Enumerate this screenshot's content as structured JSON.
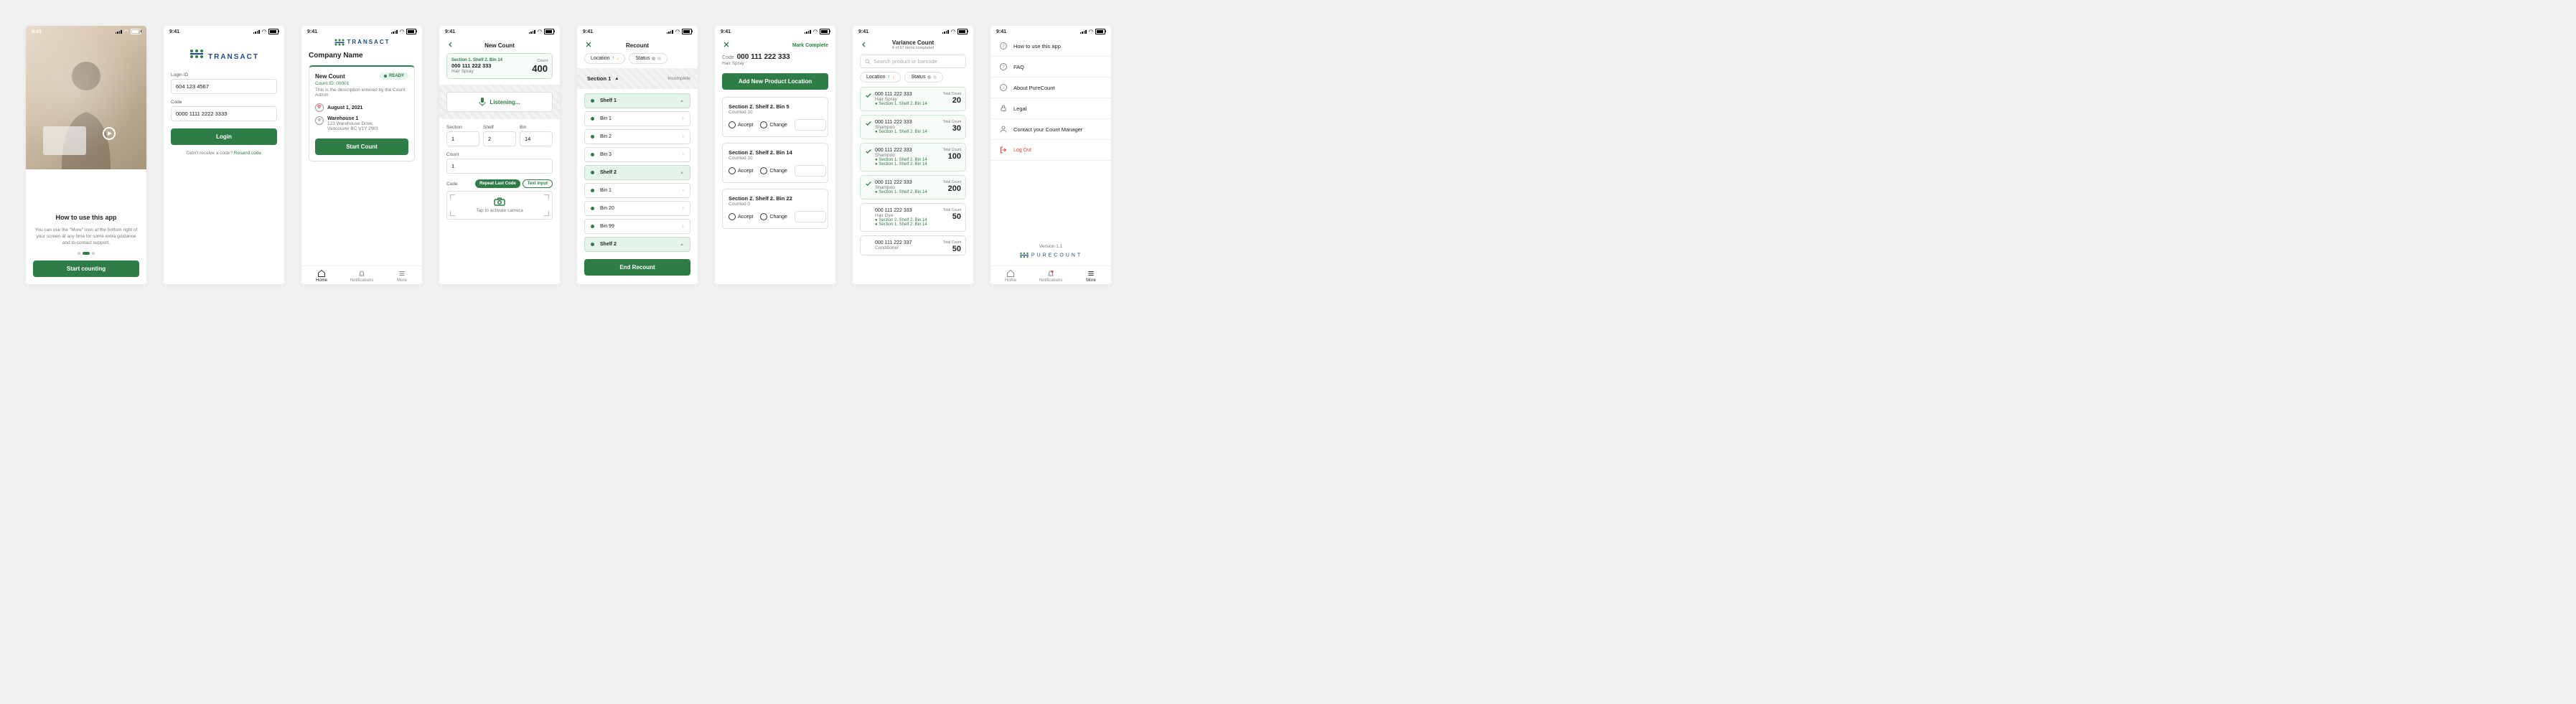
{
  "status": {
    "time": "9:41"
  },
  "brand": {
    "transact": "TRANSACT",
    "purecount": "PURECOUNT",
    "version": "Version 1.1"
  },
  "tabs": {
    "home": "Home",
    "notifications": "Notifications",
    "more": "More"
  },
  "s1": {
    "title": "How to use this app",
    "body": "You can use the \"More\" icon at the bottom right of your screen at any time for some extra guidance and to contact support.",
    "cta": "Start counting"
  },
  "s2": {
    "login_id_label": "Login ID",
    "login_id_value": "604 123 4567",
    "code_label": "Code",
    "code_value": "0000 1111 2222 3333",
    "login_btn": "Login",
    "resend_prefix": "Didn't receive a code? ",
    "resend_link": "Resend code"
  },
  "s3": {
    "company": "Company Name",
    "new_count": "New Count",
    "count_id": "Count ID: 00001",
    "desc": "This is the description entered by the Count Admin",
    "date": "August 1, 2021",
    "warehouse": "Warehouse 1",
    "address1": "123 Warehouse Drive,",
    "address2": "Vancouver BC V1Y 2W3",
    "ready": "READY",
    "start": "Start Count"
  },
  "s4": {
    "title": "New Count",
    "loc_line": "Section 1.  Shelf 2.  Bin 14",
    "code": "000 111 222 333",
    "product": "Hair Spray",
    "count_label": "Count",
    "count_value": "400",
    "listening": "Listening...",
    "section_label": "Section",
    "shelf_label": "Shelf",
    "bin_label": "Bin",
    "section_val": "1",
    "shelf_val": "2",
    "bin_val": "14",
    "count_label2": "Count",
    "count_val2": "1",
    "code_label": "Code",
    "repeat": "Repeat Last Code",
    "text_input": "Text Input",
    "tap_camera": "Tap to activate camera"
  },
  "s5": {
    "title": "Recount",
    "loc_filter": "Location",
    "status_filter": "Status",
    "section1": "Section 1",
    "incomplete": "Incomplete",
    "shelf1": "Shelf 1",
    "bins_a": [
      "Bin 1",
      "Bin 2",
      "Bin 3"
    ],
    "shelf2": "Shelf 2",
    "bins_b": [
      "Bin 1",
      "Bin 20",
      "Bin 99"
    ],
    "shelf2b": "Shelf 2",
    "end": "End Recount"
  },
  "s6": {
    "mark_complete": "Mark Complete",
    "code_label": "Code",
    "code": "000 111 222 333",
    "product": "Hair Spray",
    "add_btn": "Add New Product Location",
    "items": [
      {
        "loc": "Section 2.  Shelf 2.  Bin 5",
        "sub": "Counted 10"
      },
      {
        "loc": "Section 2.  Shelf 2.  Bin 14",
        "sub": "Counted 10"
      },
      {
        "loc": "Section 2.  Shelf 2.  Bin 22",
        "sub": "Counted 0"
      }
    ],
    "accept": "Accept",
    "change": "Change"
  },
  "s7": {
    "title": "Variance Count",
    "subtitle": "4 of 67 items completed",
    "search_ph": "Search product or barcode",
    "loc_filter": "Location",
    "status_filter": "Status",
    "total_count_label": "Total Count",
    "items": [
      {
        "done": true,
        "code": "000 111 222 333",
        "name": "Hair Spray",
        "locs": [
          "Section 1.  Shelf 2.  Bin 14"
        ],
        "count": "20"
      },
      {
        "done": true,
        "code": "000 111 222 333",
        "name": "Shampoo",
        "locs": [
          "Section 1.  Shelf 2.  Bin 14"
        ],
        "count": "30"
      },
      {
        "done": true,
        "code": "000 111 222 333",
        "name": "Shampoo",
        "locs": [
          "Section 1.  Shelf 2.  Bin 14",
          "Section 1.  Shelf 2.  Bin 14"
        ],
        "count": "100"
      },
      {
        "done": true,
        "code": "000 111 222 333",
        "name": "Shampoo",
        "locs": [
          "Section 1.  Shelf 2.  Bin 14"
        ],
        "count": "200"
      },
      {
        "done": false,
        "code": "000 111 222 333",
        "name": "Hair Dye",
        "locs": [
          "Section 2.  Shelf 2.  Bin 14",
          "Section 1.  Shelf 2.  Bin 14"
        ],
        "count": "50"
      },
      {
        "done": false,
        "code": "000 111 222 337",
        "name": "Conditioner",
        "locs": [],
        "count": "50"
      }
    ]
  },
  "s8": {
    "items": [
      "How to use this app",
      "FAQ",
      "About PureCount",
      "Legal",
      "Contact your Count Manager"
    ],
    "logout": "Log Out"
  }
}
